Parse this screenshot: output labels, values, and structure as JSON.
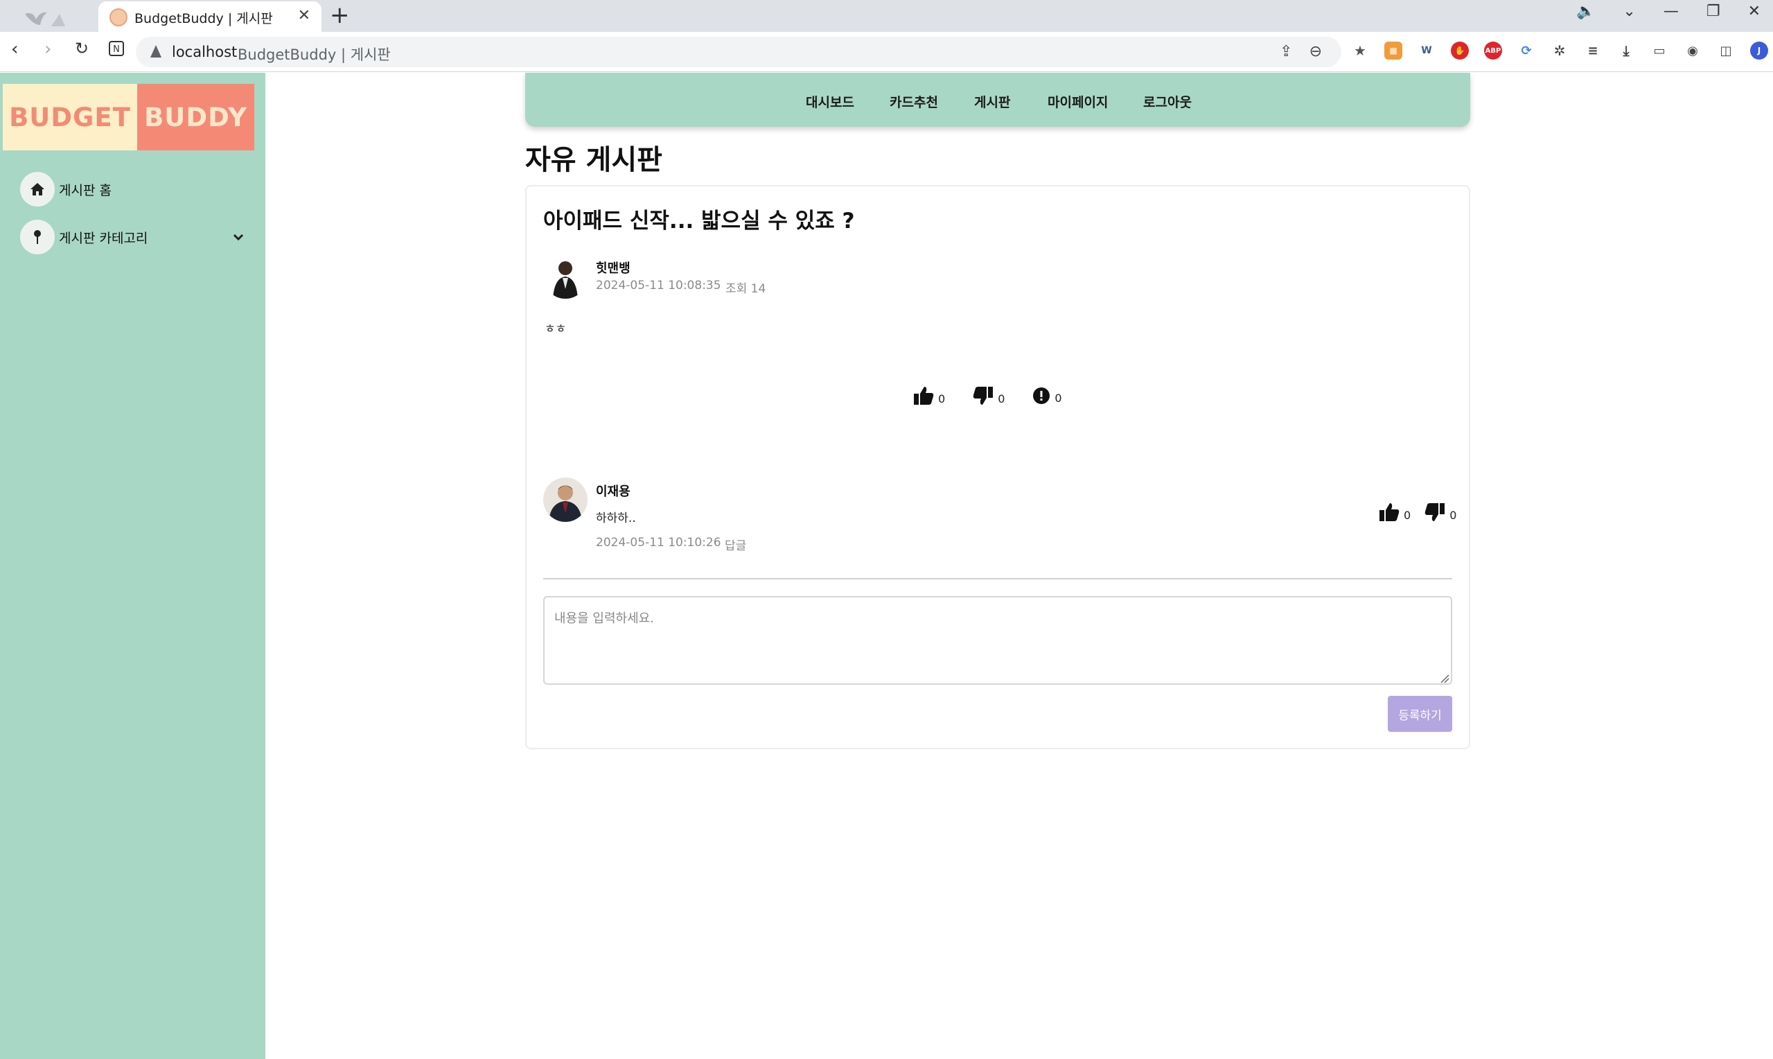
{
  "browser": {
    "tab_title": "BudgetBuddy | 게시판",
    "url_host": "localhost",
    "url_title": "BudgetBuddy | 게시판"
  },
  "logo": {
    "left": "BUDGET",
    "right": "BUDDY"
  },
  "sidebar": {
    "items": [
      {
        "label": "게시판 홈",
        "icon": "home-icon"
      },
      {
        "label": "게시판 카테고리",
        "icon": "pin-icon"
      }
    ]
  },
  "topnav": {
    "items": [
      "대시보드",
      "카드추천",
      "게시판",
      "마이페이지",
      "로그아웃"
    ]
  },
  "page": {
    "title": "자유 게시판"
  },
  "post": {
    "title": "아이패드 신작... 밟으실 수 있죠 ?",
    "author": "힛맨뱅",
    "datetime": "2024-05-11 10:08:35",
    "views": "조회 14",
    "content": "ㅎㅎ",
    "likes": "0",
    "dislikes": "0",
    "reports": "0"
  },
  "comment": {
    "author": "이재용",
    "content": "하하하..",
    "datetime": "2024-05-11 10:10:26",
    "reply_label": "답글",
    "likes": "0",
    "dislikes": "0"
  },
  "comment_form": {
    "placeholder": "내용을 입력하세요.",
    "submit_label": "등록하기"
  },
  "colors": {
    "mint": "#a8d7c5",
    "logo_cream": "#fdf0c8",
    "logo_salmon": "#f48a76",
    "submit_purple": "#b4a6e0"
  }
}
